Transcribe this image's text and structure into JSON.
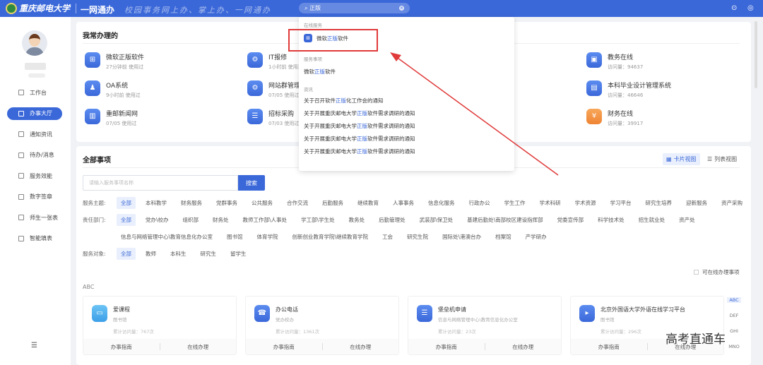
{
  "header": {
    "university": "重庆邮电大学",
    "app_name": "一网通办",
    "slogan": "校园事务网上办、掌上办、一网通办",
    "search_value": "正版"
  },
  "sidebar": {
    "items": [
      {
        "label": "工作台"
      },
      {
        "label": "办事大厅",
        "active": true
      },
      {
        "label": "通知资讯"
      },
      {
        "label": "待办/消息"
      },
      {
        "label": "服务效能"
      },
      {
        "label": "数字签章"
      },
      {
        "label": "师生一张表"
      },
      {
        "label": "智能填表"
      }
    ]
  },
  "frequent": {
    "title": "我常办理的",
    "items": [
      {
        "name": "微软正版软件",
        "sub": "27分钟前 使用过"
      },
      {
        "name": "OA系统",
        "sub": "9小时前 使用过"
      },
      {
        "name": "重邮新闻网",
        "sub": "07/05 使用过"
      },
      {
        "name": "IT报修",
        "sub": "1小时前 使用过"
      },
      {
        "name": "网站群管理",
        "sub": "07/05 使用过"
      },
      {
        "name": "招标采购",
        "sub": "07/03 使用过"
      },
      {
        "name": "教务在线",
        "sub": "访问量：94637"
      },
      {
        "name": "本科毕业设计管理系统",
        "sub": "访问量：46646"
      },
      {
        "name": "财务在线",
        "sub": "访问量：39917"
      }
    ]
  },
  "dropdown": {
    "sec_online": "在线服务",
    "online_pre": "微软",
    "online_hl": "正版",
    "online_post": "软件",
    "sec_items": "服务事项",
    "item_pre": "微软",
    "item_hl": "正版",
    "item_post": "软件",
    "sec_news": "资讯",
    "news": [
      {
        "pre": "关于召开软件",
        "hl": "正版",
        "post": "化工作会的通知"
      },
      {
        "pre": "关于开展重庆邮电大学",
        "hl": "正版",
        "post": "软件需求调研的通知"
      },
      {
        "pre": "关于开展重庆邮电大学",
        "hl": "正版",
        "post": "软件需求调研的通知"
      },
      {
        "pre": "关于开展重庆邮电大学",
        "hl": "正版",
        "post": "软件需求调研的通知"
      },
      {
        "pre": "关于开展重庆邮电大学",
        "hl": "正版",
        "post": "软件需求调研的通知"
      }
    ]
  },
  "all": {
    "title": "全部事项",
    "card_view": "卡片视图",
    "list_view": "列表视图",
    "search_placeholder": "请输入服务事项名称",
    "search_btn": "搜索",
    "filters": [
      {
        "label": "服务主题:",
        "tags": [
          "全部",
          "本科教学",
          "财务服务",
          "党群事务",
          "公共服务",
          "合作交流",
          "后勤服务",
          "继续教育",
          "人事事务",
          "信息化服务",
          "行政办公",
          "学生工作",
          "学术科研",
          "学术资源",
          "学习平台",
          "研究生培养",
          "迎新服务",
          "资产采购"
        ]
      },
      {
        "label": "责任部门:",
        "tags": [
          "全部",
          "党办\\校办",
          "组织部",
          "财务处",
          "教师工作部\\人事处",
          "学工部\\学生处",
          "教务处",
          "后勤管理处",
          "武装部\\保卫处",
          "基建后勤处\\南部校区建设指挥部",
          "党委宣传部",
          "科学技术处",
          "招生就业处",
          "资产处"
        ]
      },
      {
        "label": "",
        "tags": [
          "信息与网络管理中心\\教育信息化办公室",
          "图书馆",
          "体育学院",
          "创新创业教育学院\\继续教育学院",
          "工会",
          "研究生院",
          "国际处\\港澳台办",
          "档案馆",
          "产学研办"
        ]
      },
      {
        "label": "服务对象:",
        "tags": [
          "全部",
          "教师",
          "本科生",
          "研究生",
          "留学生"
        ]
      }
    ],
    "online_only": "可在线办理事项",
    "group": "ABC",
    "services": [
      {
        "name": "爱课程",
        "dept": "图书馆",
        "visits": "累计访问量：767次"
      },
      {
        "name": "办公电话",
        "dept": "党办校办",
        "visits": "累计访问量：1361次"
      },
      {
        "name": "堡垒机申请",
        "dept": "信息与网络管理中心\\教育信息化办公室",
        "visits": "累计访问量：23次"
      },
      {
        "name": "北京外国语大学外语在线学习平台",
        "dept": "图书馆",
        "visits": "累计访问量：296次"
      }
    ],
    "guide": "办事指南",
    "online": "在线办理",
    "alphabet": [
      "ABC",
      "DEF",
      "GHI",
      "MNO"
    ]
  },
  "watermark": "高考直通车"
}
